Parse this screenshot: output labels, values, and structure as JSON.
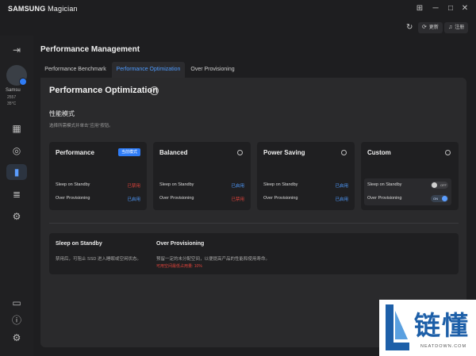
{
  "app": {
    "brand_bold": "SAMSUNG",
    "brand_rest": " Magician"
  },
  "window": {
    "controls": [
      "⊞",
      "─",
      "□",
      "✕"
    ]
  },
  "header": {
    "refresh_icon": "refresh-icon",
    "update_label": "更新",
    "register_label": "注册"
  },
  "sidebar": {
    "collapse_icon": "⇥",
    "device": {
      "name": "Samsu",
      "meta1": "2557",
      "meta2": "35°C"
    },
    "items": [
      {
        "name": "sidebar-item-dashboard",
        "icon": "▦"
      },
      {
        "name": "sidebar-item-diagnostics",
        "icon": "◎"
      },
      {
        "name": "sidebar-item-performance",
        "icon": "▮"
      },
      {
        "name": "sidebar-item-data",
        "icon": "≣"
      },
      {
        "name": "sidebar-item-security",
        "icon": "⚙"
      }
    ],
    "bottom": [
      "▭",
      "ⓘ",
      "⚙"
    ]
  },
  "main": {
    "title": "Performance Management",
    "tabs": [
      {
        "label": "Performance Benchmark"
      },
      {
        "label": "Performance Optimization"
      },
      {
        "label": "Over Provisioning"
      }
    ],
    "section_title": "Performance Optimization",
    "mode_title": "性能模式",
    "mode_desc": "选择所需模式并单击“应用”按钮。",
    "cards": [
      {
        "name": "Performance",
        "badge": "当前模式",
        "rows": [
          {
            "label": "Sleep on Standby",
            "value": "已禁用",
            "color": "#e0433b"
          },
          {
            "label": "Over Provisioning",
            "value": "已启用",
            "color": "#4e9bff"
          }
        ]
      },
      {
        "name": "Balanced",
        "rows": [
          {
            "label": "Sleep on Standby",
            "value": "已启用",
            "color": "#4e9bff"
          },
          {
            "label": "Over Provisioning",
            "value": "已禁用",
            "color": "#e0433b"
          }
        ]
      },
      {
        "name": "Power Saving",
        "rows": [
          {
            "label": "Sleep on Standby",
            "value": "已启用",
            "color": "#4e9bff"
          },
          {
            "label": "Over Provisioning",
            "value": "已启用",
            "color": "#4e9bff"
          }
        ]
      },
      {
        "name": "Custom",
        "rows": [
          {
            "label": "Sleep on Standby",
            "toggle": "OFF"
          },
          {
            "label": "Over Provisioning",
            "toggle": "ON"
          }
        ]
      }
    ],
    "info": {
      "sleep_title": "Sleep on Standby",
      "sleep_text": "禁用后，可阻止 SSD 进入睡眠或空闲状态。",
      "op_title": "Over Provisioning",
      "op_text": "预留一定的未分配空间，以便提高产品的性能和使用寿命。",
      "op_warn": "可用空间最低占用量: 10%"
    }
  },
  "watermark": {
    "cn": "链懂",
    "en": "NEATDOWN.COM"
  }
}
